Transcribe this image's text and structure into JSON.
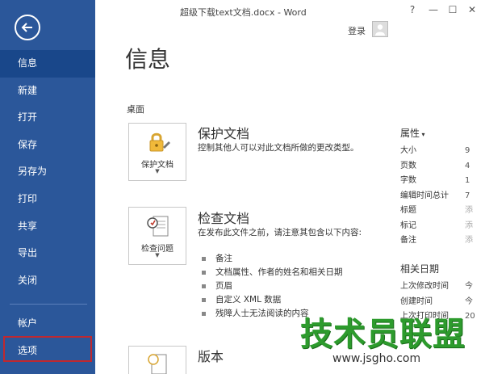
{
  "window": {
    "title": "超级下载text文档.docx - Word",
    "controls": [
      "?",
      "—",
      "☐",
      "✕"
    ],
    "signin": "登录"
  },
  "sidebar": {
    "items": [
      {
        "label": "信息",
        "active": true
      },
      {
        "label": "新建"
      },
      {
        "label": "打开"
      },
      {
        "label": "保存"
      },
      {
        "label": "另存为"
      },
      {
        "label": "打印"
      },
      {
        "label": "共享"
      },
      {
        "label": "导出"
      },
      {
        "label": "关闭"
      }
    ],
    "bottom_items": [
      {
        "label": "帐户"
      },
      {
        "label": "选项"
      }
    ],
    "colors": {
      "bg": "#2b579a",
      "active": "#19478a",
      "highlight_border": "#c0282f"
    }
  },
  "main": {
    "title": "信息",
    "location": "桌面",
    "protect": {
      "button_label": "保护文档",
      "title": "保护文档",
      "desc": "控制其他人可以对此文档所做的更改类型。"
    },
    "inspect": {
      "button_label": "检查问题",
      "title": "检查文档",
      "desc": "在发布此文件之前，请注意其包含以下内容:",
      "bullets": [
        "备注",
        "文档属性、作者的姓名和相关日期",
        "页眉",
        "自定义 XML 数据",
        "残障人士无法阅读的内容"
      ]
    },
    "versions": {
      "title": "版本"
    }
  },
  "properties": {
    "header": "属性",
    "rows": [
      {
        "k": "大小",
        "v": "9"
      },
      {
        "k": "页数",
        "v": "4"
      },
      {
        "k": "字数",
        "v": "1"
      },
      {
        "k": "编辑时间总计",
        "v": "7"
      },
      {
        "k": "标题",
        "v": "添"
      },
      {
        "k": "标记",
        "v": "添"
      },
      {
        "k": "备注",
        "v": "添"
      }
    ],
    "dates_header": "相关日期",
    "dates": [
      {
        "k": "上次修改时间",
        "v": "今"
      },
      {
        "k": "创建时间",
        "v": "今"
      },
      {
        "k": "上次打印时间",
        "v": "20"
      }
    ]
  },
  "watermark": {
    "main": "技术员联盟",
    "url": "www.jsgho.com"
  }
}
